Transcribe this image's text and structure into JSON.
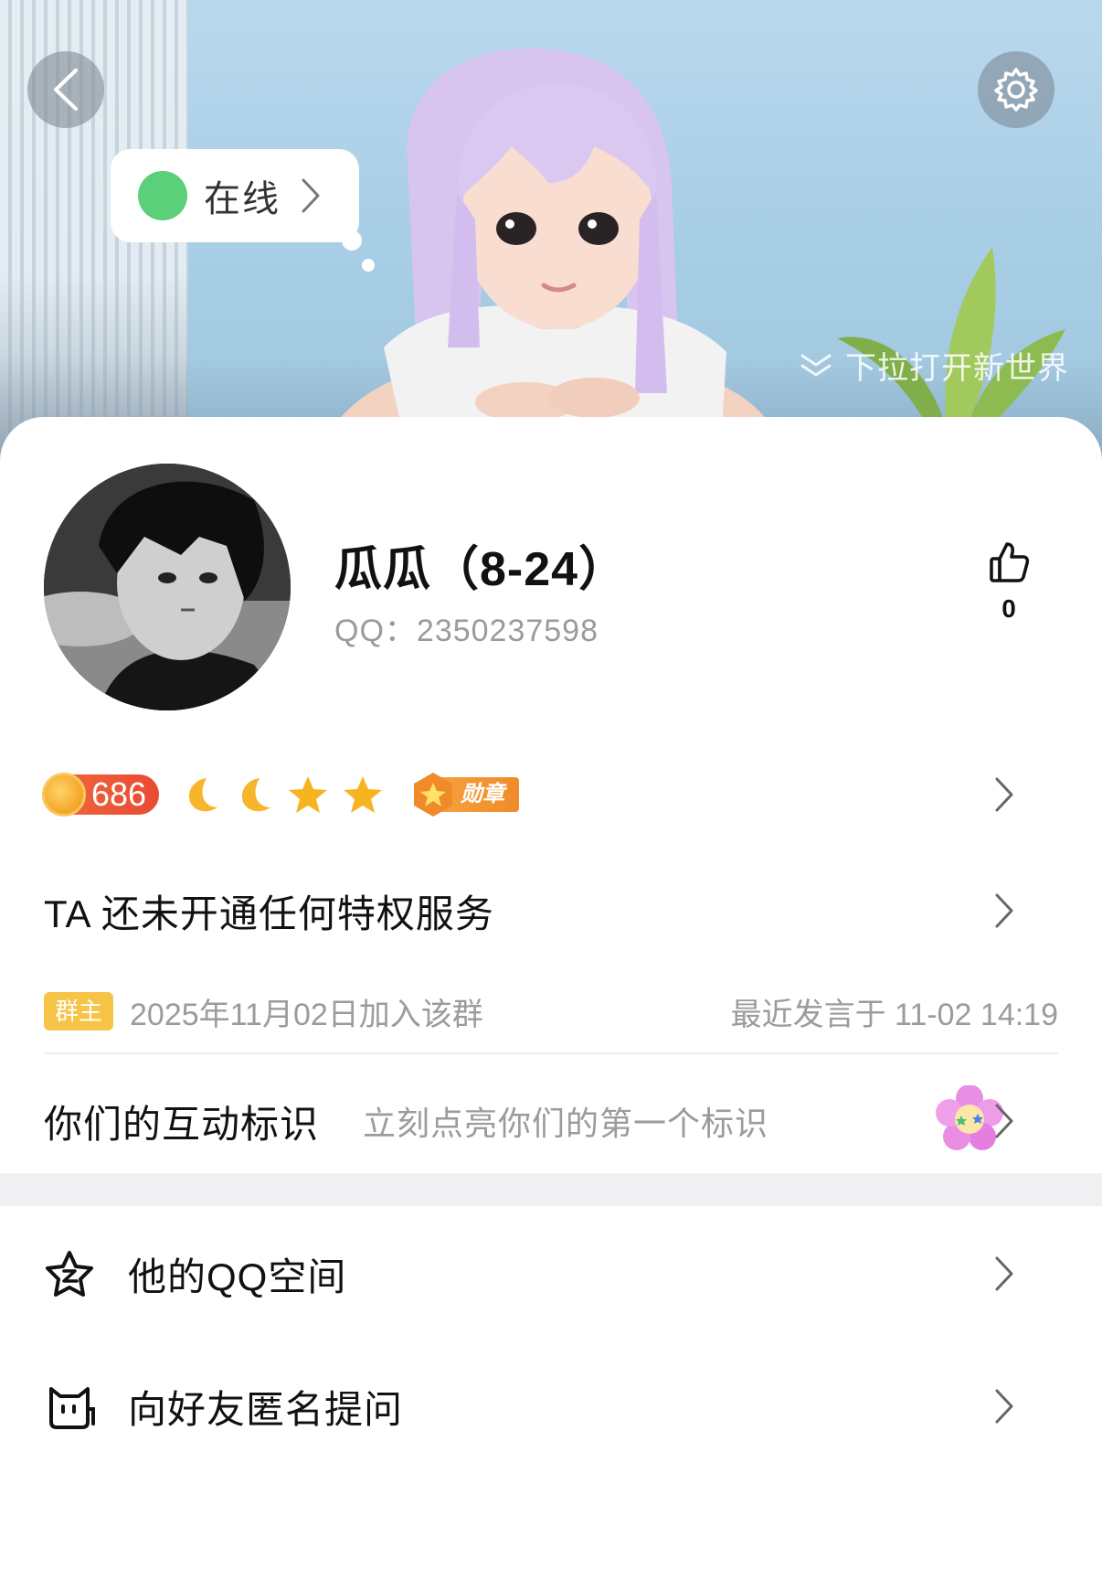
{
  "header": {
    "status": "在线",
    "pull_hint": "下拉打开新世界"
  },
  "profile": {
    "nickname": "瓜瓜（8-24）",
    "qq_label": "QQ：",
    "qq_number": "2350237598",
    "likes": "0"
  },
  "level": {
    "value": "686",
    "icons": [
      "moon-icon",
      "moon-icon",
      "star-icon",
      "star-icon"
    ],
    "medal_label": "勋章"
  },
  "privilege": {
    "text": "TA 还未开通任何特权服务"
  },
  "group": {
    "role_tag": "群主",
    "join_text": "2025年11月02日加入该群",
    "last_speak": "最近发言于 11-02 14:19"
  },
  "interaction": {
    "title": "你们的互动标识",
    "subtitle": "立刻点亮你们的第一个标识"
  },
  "menu": [
    {
      "label": "他的QQ空间",
      "icon": "qzone-star-icon"
    },
    {
      "label": "向好友匿名提问",
      "icon": "cat-icon"
    }
  ],
  "colors": {
    "online": "#5ad07b",
    "level_bg": "#e94a35",
    "owner_tag": "#f6c447",
    "medal": "#f08a2a"
  }
}
